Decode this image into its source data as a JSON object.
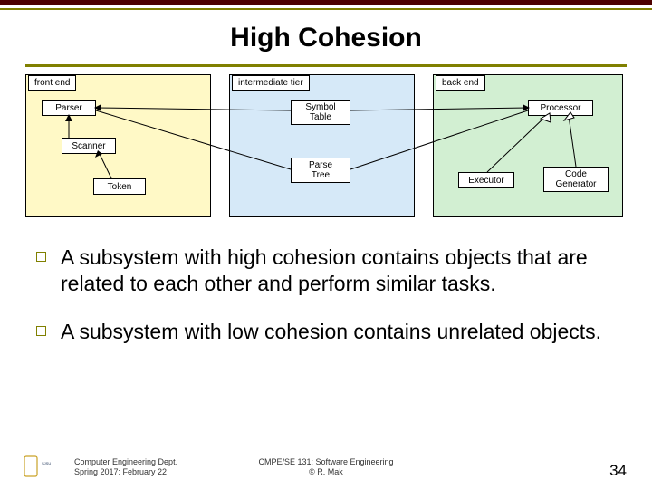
{
  "title": "High Cohesion",
  "diagram": {
    "tiers": {
      "front": "front end",
      "mid": "intermediate tier",
      "back": "back end"
    },
    "nodes": {
      "parser": "Parser",
      "scanner": "Scanner",
      "token": "Token",
      "symbol_table": "Symbol\nTable",
      "parse_tree": "Parse\nTree",
      "processor": "Processor",
      "executor": "Executor",
      "code_generator": "Code\nGenerator"
    }
  },
  "bullets": [
    {
      "pre": "A subsystem with high cohesion contains objects that are ",
      "u1": "related to each other",
      "mid": " and ",
      "u2": "perform similar tasks",
      "post": "."
    },
    {
      "pre": "A subsystem with low cohesion contains unrelated objects.",
      "u1": "",
      "mid": "",
      "u2": "",
      "post": ""
    }
  ],
  "footer": {
    "dept": "Computer Engineering Dept.",
    "date": "Spring 2017: February 22",
    "course": "CMPE/SE 131: Software Engineering",
    "copyright": "© R. Mak",
    "page": "34",
    "university": "San José State"
  }
}
